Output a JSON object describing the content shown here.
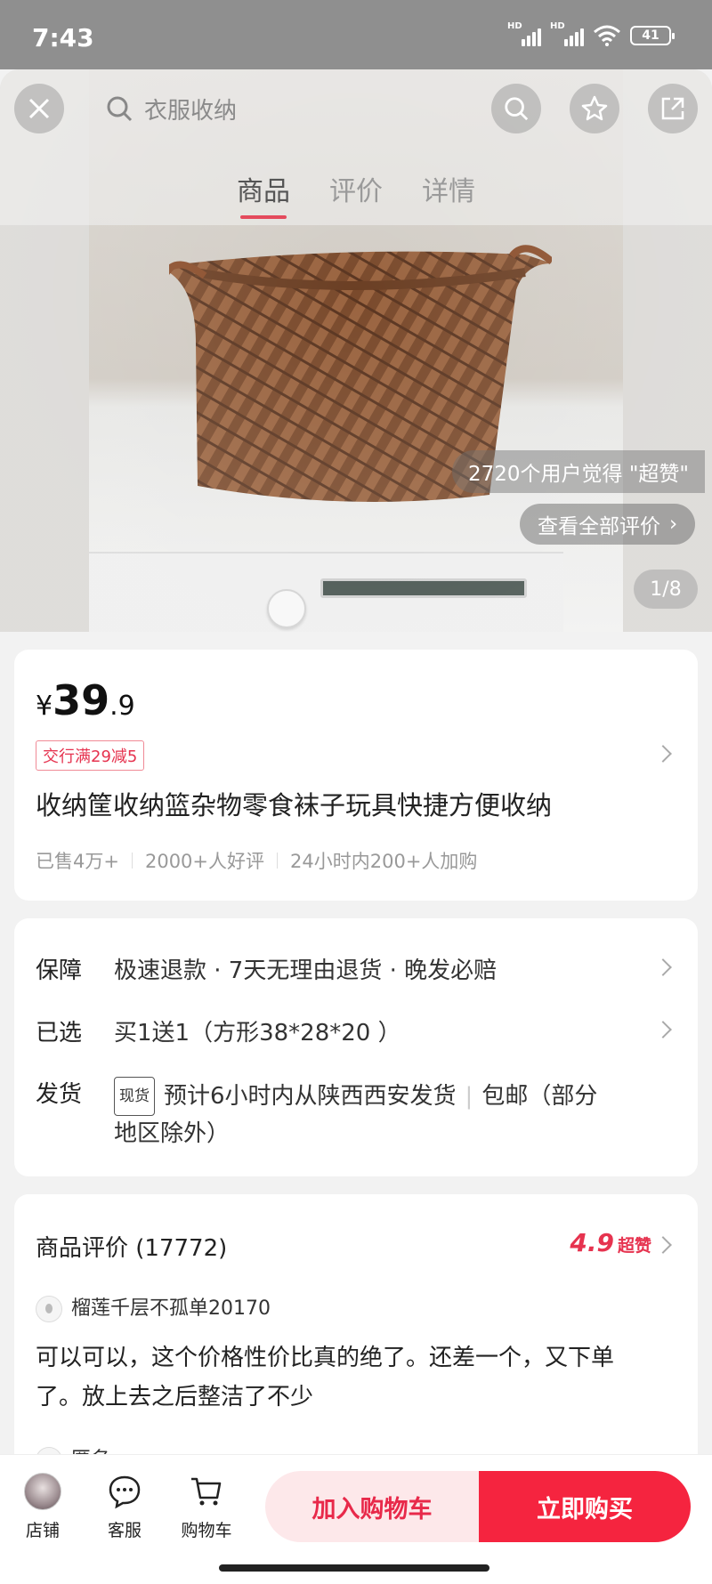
{
  "status_bar": {
    "time": "7:43",
    "battery": "41",
    "signal_label": "HD"
  },
  "header": {
    "search_placeholder": "衣服收纳",
    "tabs": [
      {
        "label": "商品",
        "active": true
      },
      {
        "label": "评价",
        "active": false
      },
      {
        "label": "详情",
        "active": false
      }
    ]
  },
  "gallery": {
    "praise_text": "2720个用户觉得 \"超赞\"",
    "view_all_reviews": "查看全部评价",
    "page_indicator": "1/8"
  },
  "product": {
    "currency": "¥",
    "price_int": "39",
    "price_dec": ".9",
    "coupon": "交行满29减5",
    "title": "收纳筐收纳篮杂物零食袜子玩具快捷方便收纳",
    "stats": [
      "已售4万+",
      "2000+人好评",
      "24小时内200+人加购"
    ]
  },
  "service": {
    "guarantee": {
      "label": "保障",
      "value": "极速退款 · 7天无理由退货 · 晚发必赔"
    },
    "selected": {
      "label": "已选",
      "value": "买1送1（方形38*28*20  ）"
    },
    "shipping": {
      "label": "发货",
      "tag": "现货",
      "value": "预计6小时内从陕西西安发货",
      "extra": "包邮（部分",
      "extra2": "地区除外）"
    }
  },
  "reviews": {
    "heading": "商品评价 (17772)",
    "score": "4.9",
    "score_label": "超赞",
    "items": [
      {
        "user": "榴莲千层不孤单20170",
        "text_line1": "可以可以，这个价格性价比真的绝了。还差一个，又下单",
        "text_line2": "了。放上去之后整洁了不少"
      },
      {
        "user": "匿名"
      }
    ]
  },
  "bottom_bar": {
    "store": "店铺",
    "service": "客服",
    "cart": "购物车",
    "add_to_cart": "加入购物车",
    "buy_now": "立即购买"
  },
  "colors": {
    "accent": "#f5243f",
    "accent_light": "#fde8ea",
    "rating": "#e6334f"
  }
}
